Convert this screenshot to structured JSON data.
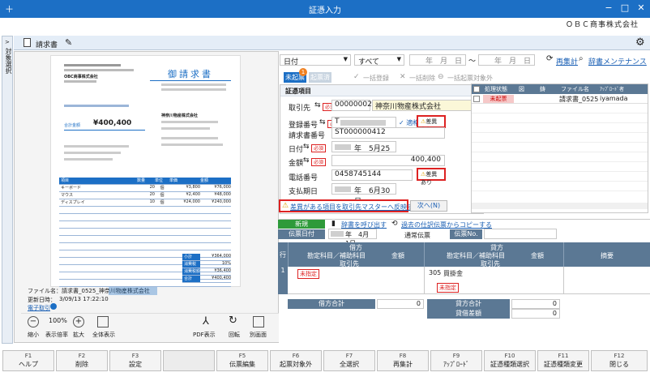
{
  "window": {
    "title": "証憑入力",
    "app_icon": "＋",
    "controls": {
      "minimize": "−",
      "maximize": "□",
      "close": "✕"
    },
    "company": "ＯＢＣ商事株式会社"
  },
  "side_tab": "対象選択",
  "doc_toolbar": {
    "tab_label": "請求書"
  },
  "invoice": {
    "title": "御請求書",
    "recipient_company": "OBC商事株式会社",
    "total_label": "合計金額",
    "total_value": "¥400,400",
    "issuer": "神奈川物産株式会社",
    "items": [
      {
        "name": "キーボード",
        "qty": "20",
        "unit": "個",
        "price": "¥3,800",
        "amount": "¥76,000"
      },
      {
        "name": "マウス",
        "qty": "20",
        "unit": "個",
        "price": "¥2,400",
        "amount": "¥48,000"
      },
      {
        "name": "ディスプレイ",
        "qty": "10",
        "unit": "個",
        "price": "¥24,000",
        "amount": "¥240,000"
      }
    ],
    "columns": [
      "項目",
      "数量",
      "単位",
      "単価",
      "金額"
    ],
    "summary": [
      {
        "label": "小計",
        "value": "¥364,000"
      },
      {
        "label": "消費税",
        "value": "10%"
      },
      {
        "label": "消費税額",
        "value": "¥36,400"
      },
      {
        "label": "合計",
        "value": "¥400,400"
      }
    ]
  },
  "file_info": {
    "filename_label": "ファイル名：請求書_0525_神奈川物産株式会社",
    "updated_label": "更新日時：",
    "updated_value": "3/09/13 17:22:10",
    "link": "電子取引"
  },
  "viewer_controls": {
    "zoom_out": "縮小",
    "zoom_value": "100%",
    "zoom_label": "表示倍率",
    "zoom_in": "拡大",
    "fit_page": "全体表示",
    "pdf_view": "PDF表示",
    "rotate": "回転",
    "separate_view": "別画面"
  },
  "filter": {
    "date_type": "日付",
    "scope": "すべて",
    "date_from_placeholder": "年　月　日",
    "date_to_placeholder": "年　月　日",
    "tilde": "〜",
    "recalc": "再集計",
    "dict_maint": "辞書メンテナンス"
  },
  "status_tabs": {
    "unregistered": "未起票",
    "unregistered_badge": "1",
    "registered": "起票済",
    "bulk_register": "一括登録",
    "bulk_delete": "一括削除",
    "bulk_exclude": "一括起票対象外"
  },
  "voucher": {
    "section_title": "証憑項目",
    "fields": [
      {
        "label": "取引先",
        "required": "必須",
        "value": "00000002",
        "value2": "神奈川物産株式会社"
      },
      {
        "label": "登録番号",
        "required": "必須",
        "value": "T",
        "extra": "✓ 適格",
        "warning": "差異あり"
      },
      {
        "label": "請求書番号",
        "value": "ST000000412"
      },
      {
        "label": "日付",
        "required": "必須",
        "value": "年　5月25日"
      },
      {
        "label": "金額",
        "required": "必須",
        "value": "400,400"
      },
      {
        "label": "電話番号",
        "value": "0458745144",
        "warning": "差異あり"
      },
      {
        "label": "支払期日",
        "value": "年　6月30日"
      }
    ],
    "reflect_link": "差異がある項目を取引先マスターへ反映する",
    "next_button": "次へ(N)"
  },
  "list_grid": {
    "columns": [
      "処理状態",
      "図",
      "鋳",
      "ファイル名",
      "ｱｯﾌﾟﾛｰﾄﾞ者"
    ],
    "rows": [
      {
        "status": "未起票",
        "file": "請求書_0525",
        "uploader": "iyamada"
      }
    ]
  },
  "journal": {
    "new_button": "新規",
    "dict_call": "辞書を呼び出す",
    "copy_past": "過去の仕訳伝票からコピーする",
    "date_label": "伝票日付",
    "date_value": "年　4月　1日",
    "normal_label": "通常伝票",
    "voucher_no_label": "伝票No.",
    "header": {
      "row": "行",
      "debit": "借方",
      "credit": "貸方",
      "account": "勘定科目／補助科目",
      "amount": "金額",
      "partner": "取引先",
      "memo": "摘要"
    },
    "rows": [
      {
        "no": "1",
        "debit_partner": "未指定",
        "credit_code": "305",
        "credit_account": "買掛金",
        "credit_partner": "未指定"
      }
    ],
    "totals": {
      "debit_total_label": "借方合計",
      "debit_total": "0",
      "credit_total_label": "貸方合計",
      "credit_total": "0",
      "diff_label": "貸借差額",
      "diff": "0"
    }
  },
  "fkeys": [
    {
      "key": "F1",
      "label": "ヘルプ"
    },
    {
      "key": "F2",
      "label": "削除"
    },
    {
      "key": "F3",
      "label": "設定"
    },
    {
      "key": "",
      "label": ""
    },
    {
      "key": "F5",
      "label": "伝票編集"
    },
    {
      "key": "F6",
      "label": "起票対象外"
    },
    {
      "key": "F7",
      "label": "全選択"
    },
    {
      "key": "F8",
      "label": "再集計"
    },
    {
      "key": "F9",
      "label": "ｱｯﾌﾟﾛｰﾄﾞ"
    },
    {
      "key": "F10",
      "label": "証憑種類選択"
    },
    {
      "key": "F11",
      "label": "証憑種類変更"
    },
    {
      "key": "F12",
      "label": "閉じる"
    }
  ],
  "colors": {
    "titlebar": "#1c6fc5",
    "accent_red": "#dd2222",
    "grid_header": "#5b7894",
    "new_green": "#2e9a3a"
  }
}
